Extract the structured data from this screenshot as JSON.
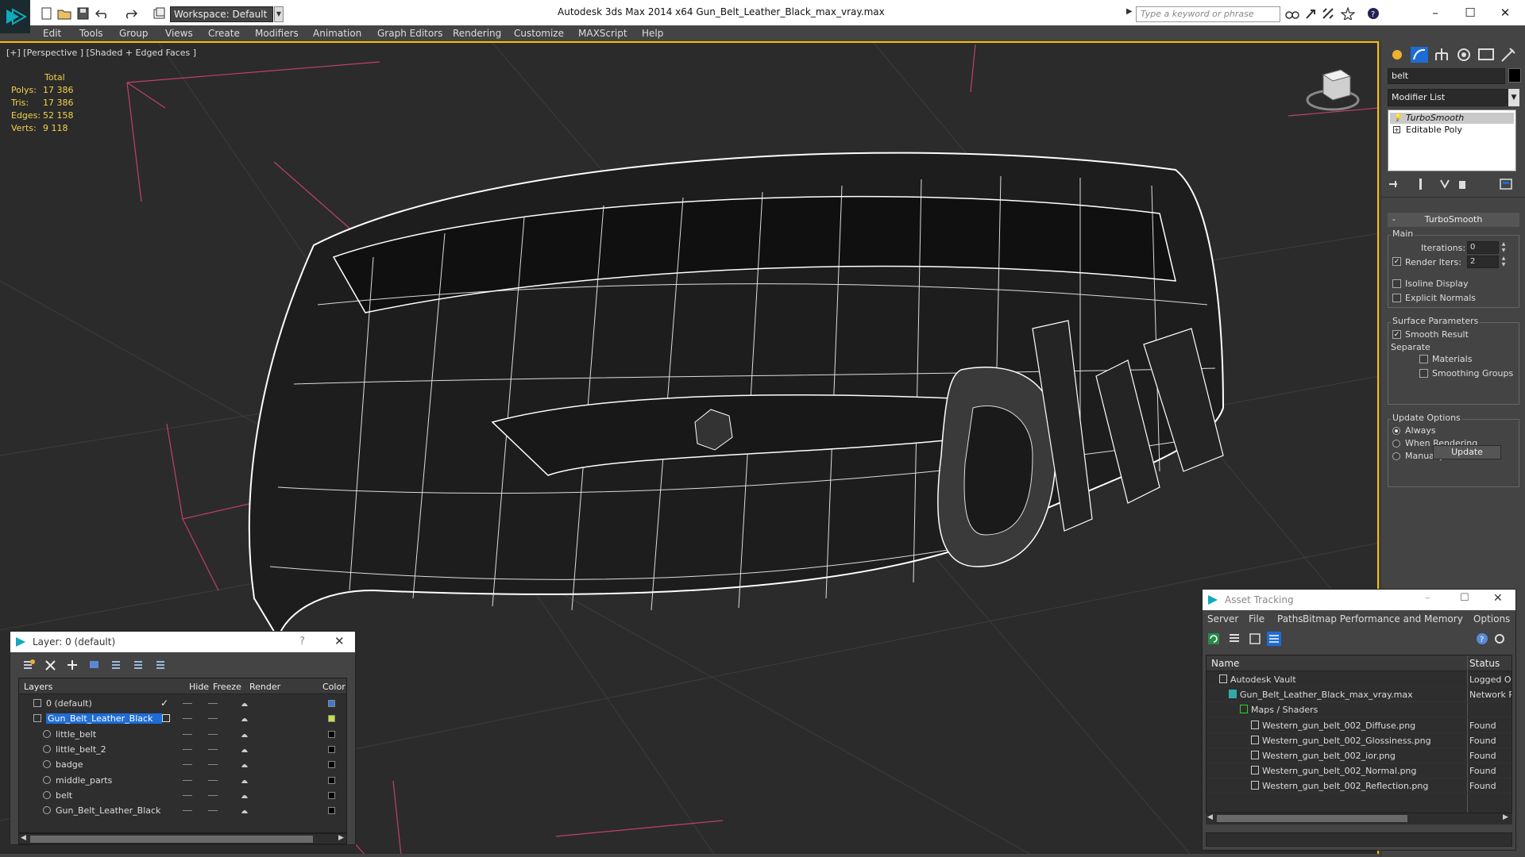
{
  "titlebar": {
    "workspace": "Workspace: Default",
    "title": "Autodesk 3ds Max  2014 x64      Gun_Belt_Leather_Black_max_vray.max",
    "search_placeholder": "Type a keyword or phrase"
  },
  "menu": [
    "Edit",
    "Tools",
    "Group",
    "Views",
    "Create",
    "Modifiers",
    "Animation",
    "Graph Editors",
    "Rendering",
    "Customize",
    "MAXScript",
    "Help"
  ],
  "viewport": {
    "label": "[+] [Perspective ] [Shaded + Edged Faces ]",
    "stats": {
      "header": "Total",
      "rows": [
        {
          "label": "Polys:",
          "value": "17 386"
        },
        {
          "label": "Tris:",
          "value": "17 386"
        },
        {
          "label": "Edges:",
          "value": "52 158"
        },
        {
          "label": "Verts:",
          "value": "9 118"
        }
      ]
    }
  },
  "command_panel": {
    "object_name": "belt",
    "modifier_list": "Modifier List",
    "stack": [
      "TurboSmooth",
      "Editable Poly"
    ],
    "rollout_title": "TurboSmooth",
    "main_group": "Main",
    "iterations_label": "Iterations:",
    "iterations_value": "0",
    "render_iters_label": "Render Iters:",
    "render_iters_value": "2",
    "isoline": "Isoline Display",
    "explicit_normals": "Explicit Normals",
    "surface_group": "Surface Parameters",
    "smooth_result": "Smooth Result",
    "separate": "Separate",
    "materials": "Materials",
    "smoothing_groups": "Smoothing Groups",
    "update_group": "Update Options",
    "always": "Always",
    "when_rendering": "When Rendering",
    "manually": "Manually",
    "update_button": "Update"
  },
  "layer_window": {
    "title": "Layer: 0 (default)",
    "help": "?",
    "headers": {
      "layers": "Layers",
      "hide": "Hide",
      "freeze": "Freeze",
      "render": "Render",
      "color": "Color"
    },
    "rows": [
      {
        "name": "0 (default)",
        "color": "#3a7bd5"
      },
      {
        "name": "Gun_Belt_Leather_Black",
        "color": "#c8e040"
      },
      {
        "name": "little_belt",
        "color": "#000000"
      },
      {
        "name": "little_belt_2",
        "color": "#000000"
      },
      {
        "name": "badge",
        "color": "#000000"
      },
      {
        "name": "middle_parts",
        "color": "#000000"
      },
      {
        "name": "belt",
        "color": "#000000"
      },
      {
        "name": "Gun_Belt_Leather_Black",
        "color": "#000000"
      }
    ]
  },
  "asset_window": {
    "title": "Asset Tracking",
    "menu": [
      "Server",
      "File",
      "Paths",
      "Bitmap Performance and Memory",
      "Options"
    ],
    "headers": {
      "name": "Name",
      "status": "Status"
    },
    "rows": [
      {
        "name": "Autodesk Vault",
        "status": "Logged Ou"
      },
      {
        "name": "Gun_Belt_Leather_Black_max_vray.max",
        "status": "Network Pa"
      },
      {
        "name": "Maps / Shaders",
        "status": ""
      },
      {
        "name": "Western_gun_belt_002_Diffuse.png",
        "status": "Found"
      },
      {
        "name": "Western_gun_belt_002_Glossiness.png",
        "status": "Found"
      },
      {
        "name": "Western_gun_belt_002_ior.png",
        "status": "Found"
      },
      {
        "name": "Western_gun_belt_002_Normal.png",
        "status": "Found"
      },
      {
        "name": "Western_gun_belt_002_Reflection.png",
        "status": "Found"
      }
    ]
  },
  "colors": {
    "viewport_bg": "#2b2b2b",
    "active_border": "#ffc000",
    "stats_text": "#f2d24a",
    "selection": "#1e6cd6",
    "grid_red": "#c0406a"
  }
}
